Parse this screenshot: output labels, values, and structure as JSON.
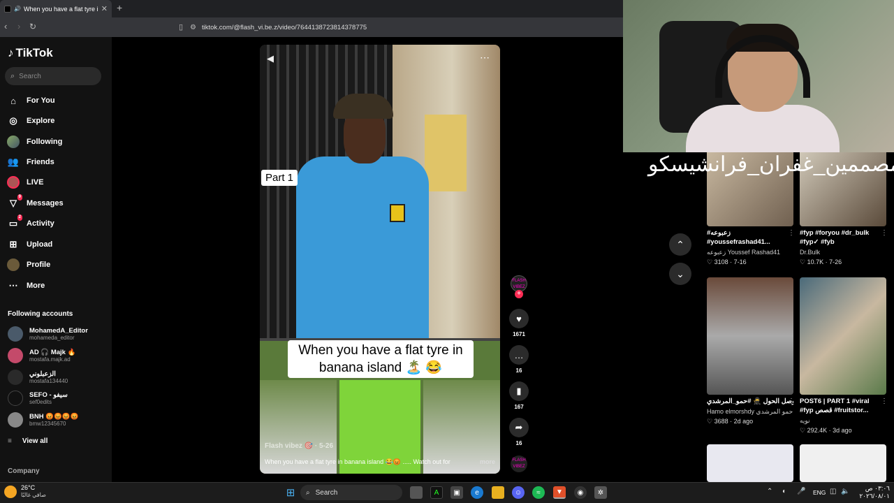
{
  "browser": {
    "tab_title": "When you have a flat tyre in l",
    "new_tab": "+",
    "url": "tiktok.com/@flash_vi.be.z/video/7644138723814378775"
  },
  "sidebar": {
    "logo": "TikTok",
    "search_placeholder": "Search",
    "items": [
      {
        "label": "For You",
        "icon": "home-icon"
      },
      {
        "label": "Explore",
        "icon": "compass-icon"
      },
      {
        "label": "Following",
        "icon": "following-avatar-icon"
      },
      {
        "label": "Friends",
        "icon": "friends-icon"
      },
      {
        "label": "LIVE",
        "icon": "live-icon"
      },
      {
        "label": "Messages",
        "icon": "messages-icon",
        "badge": "9"
      },
      {
        "label": "Activity",
        "icon": "activity-icon",
        "badge": "2"
      },
      {
        "label": "Upload",
        "icon": "upload-icon"
      },
      {
        "label": "Profile",
        "icon": "profile-avatar-icon"
      },
      {
        "label": "More",
        "icon": "more-icon"
      }
    ],
    "following_title": "Following accounts",
    "accounts": [
      {
        "name": "MohamedA_Editor",
        "handle": "mohameda_editor"
      },
      {
        "name": "AD 🎧 Majk 🔥",
        "handle": "mostafa.majk.ad"
      },
      {
        "name": "الزعبلوني",
        "handle": "mostafa134440"
      },
      {
        "name": "SEFO - سيفو",
        "handle": "sef0edits"
      },
      {
        "name": "BNH 😡😡😡😡",
        "handle": "bmw12345670"
      }
    ],
    "view_all": "View all",
    "company": "Company"
  },
  "video": {
    "part_label": "Part 1",
    "caption": "When you have a flat tyre in banana island 🏝️ 😂",
    "author": "Flash vibez 🎯 · 5-26",
    "description": "When you have a flat tyre in banana island 😂😡 ..... Watch out for",
    "more": "more",
    "creator_badge": "FLASH VIBEZ"
  },
  "actions": {
    "likes": "1671",
    "comments": "16",
    "saves": "167",
    "shares": "16"
  },
  "overlay_text": "مصممين_غفران_فرانشيسكو#",
  "recommendations": [
    {
      "tags": "#زعبوعه",
      "tags2": "#youssefrashad41...",
      "author": "زعبوعه Youssef Rashad41",
      "likes": "3108",
      "date": "7-16"
    },
    {
      "tags": "#fyp #foryou #dr_bulk",
      "tags2": "#fyp✓ #fyb",
      "author": "Dr.Bulk",
      "likes": "10.7K",
      "date": "7-26"
    },
    {
      "tags": "وصل الحول 🥷 #حمو_المرشدي",
      "tags2": "",
      "author": "Hamo elmorshdy حمو المرشدي",
      "likes": "3688",
      "date": "2d ago"
    },
    {
      "tags": "POST6 | PART 1 #viral",
      "tags2": "#fyp قصص #fruitstor...",
      "author": "نويه",
      "likes": "292.4K",
      "date": "3d ago"
    }
  ],
  "taskbar": {
    "temp": "26°C",
    "condition": "صافي غالبًا",
    "search": "Search",
    "lang": "ENG",
    "time": "٠٣:٠٦ ص",
    "date": "٢٠٢٦/٠٨/٠١"
  }
}
